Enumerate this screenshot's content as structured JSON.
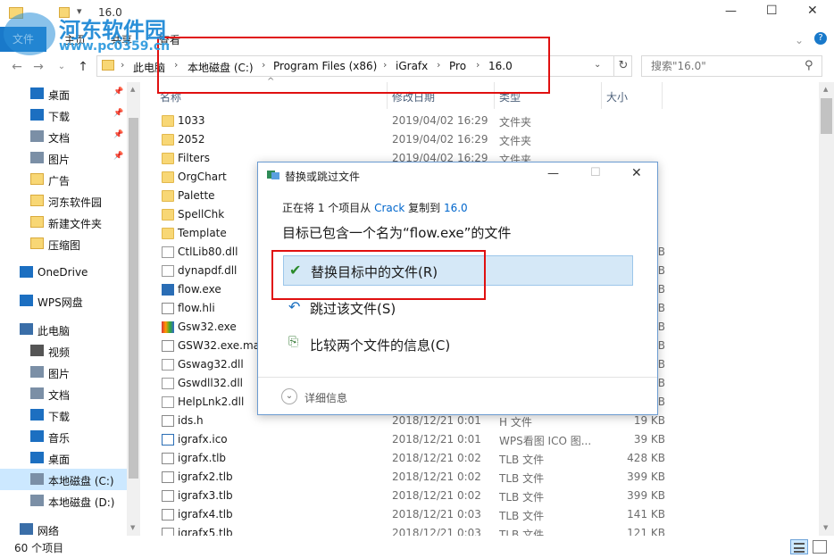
{
  "window": {
    "title": "16.0",
    "minimize": "—",
    "maximize": "☐",
    "close": "✕"
  },
  "ribbon": {
    "tabs": [
      "文件",
      "主页",
      "共享",
      "查看"
    ],
    "help": "?"
  },
  "address": {
    "crumbs": [
      "此电脑",
      "本地磁盘 (C:)",
      "Program Files (x86)",
      "iGrafx",
      "Pro",
      "16.0"
    ],
    "search_placeholder": "搜索\"16.0\""
  },
  "sidebar": {
    "items": [
      {
        "label": "桌面",
        "icon": "desktop-icon",
        "pinned": true
      },
      {
        "label": "下载",
        "icon": "download-icon",
        "pinned": true
      },
      {
        "label": "文档",
        "icon": "document-icon",
        "pinned": true
      },
      {
        "label": "图片",
        "icon": "picture-icon",
        "pinned": true
      },
      {
        "label": "广告",
        "icon": "folder-icon"
      },
      {
        "label": "河东软件园",
        "icon": "folder-icon"
      },
      {
        "label": "新建文件夹",
        "icon": "folder-icon"
      },
      {
        "label": "压缩图",
        "icon": "folder-icon"
      },
      {
        "label": "OneDrive",
        "icon": "cloud-icon"
      },
      {
        "label": "WPS网盘",
        "icon": "cloud-icon"
      },
      {
        "label": "此电脑",
        "icon": "computer-icon"
      },
      {
        "label": "视频",
        "icon": "video-icon"
      },
      {
        "label": "图片",
        "icon": "picture-icon"
      },
      {
        "label": "文档",
        "icon": "document-icon"
      },
      {
        "label": "下载",
        "icon": "download-icon"
      },
      {
        "label": "音乐",
        "icon": "music-icon"
      },
      {
        "label": "桌面",
        "icon": "desktop-icon"
      },
      {
        "label": "本地磁盘 (C:)",
        "icon": "drive-icon",
        "selected": true
      },
      {
        "label": "本地磁盘 (D:)",
        "icon": "drive-icon"
      },
      {
        "label": "网络",
        "icon": "network-icon"
      }
    ]
  },
  "columns": {
    "name": "名称",
    "date": "修改日期",
    "type": "类型",
    "size": "大小"
  },
  "files": [
    {
      "name": "1033",
      "date": "2019/04/02 16:29",
      "type": "文件夹",
      "size": "",
      "kind": "folder"
    },
    {
      "name": "2052",
      "date": "2019/04/02 16:29",
      "type": "文件夹",
      "size": "",
      "kind": "folder"
    },
    {
      "name": "Filters",
      "date": "2019/04/02 16:29",
      "type": "文件夹",
      "size": "",
      "kind": "folder"
    },
    {
      "name": "OrgChart",
      "date": "",
      "type": "",
      "size": "",
      "kind": "folder"
    },
    {
      "name": "Palette",
      "date": "",
      "type": "",
      "size": "",
      "kind": "folder"
    },
    {
      "name": "SpellChk",
      "date": "",
      "type": "",
      "size": "",
      "kind": "folder"
    },
    {
      "name": "Template",
      "date": "",
      "type": "",
      "size": "",
      "kind": "folder"
    },
    {
      "name": "CtlLib80.dll",
      "date": "",
      "type": "",
      "size": "B",
      "kind": "dll"
    },
    {
      "name": "dynapdf.dll",
      "date": "",
      "type": "",
      "size": "B",
      "kind": "dll"
    },
    {
      "name": "flow.exe",
      "date": "",
      "type": "",
      "size": "B",
      "kind": "exe"
    },
    {
      "name": "flow.hli",
      "date": "",
      "type": "",
      "size": "B",
      "kind": "file"
    },
    {
      "name": "Gsw32.exe",
      "date": "",
      "type": "",
      "size": "B",
      "kind": "exe2"
    },
    {
      "name": "GSW32.exe.mar",
      "date": "",
      "type": "",
      "size": "B",
      "kind": "file"
    },
    {
      "name": "Gswag32.dll",
      "date": "",
      "type": "",
      "size": "B",
      "kind": "dll"
    },
    {
      "name": "Gswdll32.dll",
      "date": "",
      "type": "",
      "size": "B",
      "kind": "dll"
    },
    {
      "name": "HelpLnk2.dll",
      "date": "",
      "type": "",
      "size": "B",
      "kind": "dll"
    },
    {
      "name": "ids.h",
      "date": "2018/12/21 0:01",
      "type": "H 文件",
      "size": "19 KB",
      "kind": "file"
    },
    {
      "name": "igrafx.ico",
      "date": "2018/12/21 0:01",
      "type": "WPS看图 ICO 图...",
      "size": "39 KB",
      "kind": "ico"
    },
    {
      "name": "igrafx.tlb",
      "date": "2018/12/21 0:02",
      "type": "TLB 文件",
      "size": "428 KB",
      "kind": "file"
    },
    {
      "name": "igrafx2.tlb",
      "date": "2018/12/21 0:02",
      "type": "TLB 文件",
      "size": "399 KB",
      "kind": "file"
    },
    {
      "name": "igrafx3.tlb",
      "date": "2018/12/21 0:02",
      "type": "TLB 文件",
      "size": "399 KB",
      "kind": "file"
    },
    {
      "name": "igrafx4.tlb",
      "date": "2018/12/21 0:03",
      "type": "TLB 文件",
      "size": "141 KB",
      "kind": "file"
    },
    {
      "name": "igrafx5.tlb",
      "date": "2018/12/21 0:03",
      "type": "TLB 文件",
      "size": "121 KB",
      "kind": "file"
    }
  ],
  "status": {
    "count": "60 个项目"
  },
  "dialog": {
    "title": "替换或跳过文件",
    "line1_pre": "正在将 1 个项目从 ",
    "line1_src": "Crack",
    "line1_mid": " 复制到 ",
    "line1_dst": "16.0",
    "heading": "目标已包含一个名为“flow.exe”的文件",
    "opt_replace": "替换目标中的文件(R)",
    "opt_skip": "跳过该文件(S)",
    "opt_compare": "比较两个文件的信息(C)",
    "details": "详细信息",
    "accent": "#0066cc"
  },
  "watermark": {
    "site_name": "河东软件园",
    "url": "www.pc0359.cn"
  }
}
